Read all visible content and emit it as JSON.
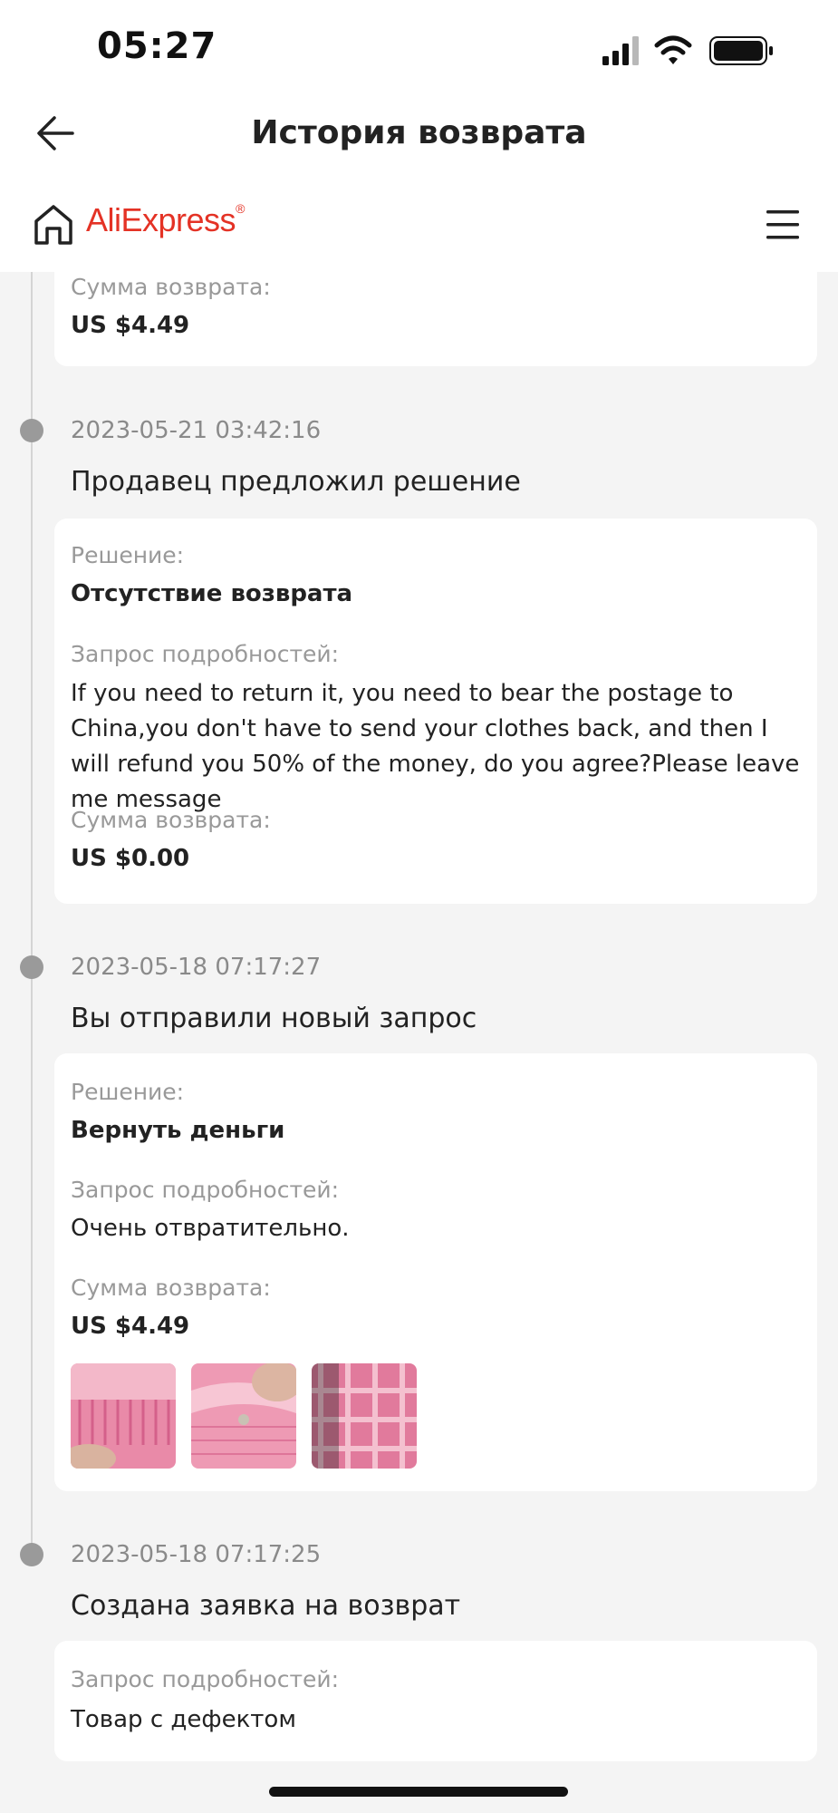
{
  "status_bar": {
    "time": "05:27"
  },
  "header": {
    "title": "История возврата"
  },
  "brand": {
    "part1": "Ali",
    "part2": "Express",
    "tm": "®"
  },
  "icons": {
    "back": "arrow-left-icon",
    "home": "home-icon",
    "menu": "hamburger-menu-icon",
    "signal": "cellular-signal-icon",
    "wifi": "wifi-icon",
    "battery": "battery-icon"
  },
  "colors": {
    "brand": "#e43225",
    "timeline_dot": "#9a9a9a",
    "background": "#f4f4f4"
  },
  "top_card": {
    "amount_label": "Сумма возврата:",
    "amount_value": "US $4.49"
  },
  "events": [
    {
      "date": "2023-05-21 03:42:16",
      "title": "Продавец предложил решение",
      "solution_label": "Решение:",
      "solution_value": "Отсутствие возврата",
      "details_label": "Запрос подробностей:",
      "details_value": "If you need to return it, you need to bear the postage to China,you don't have to send your clothes back, and then I will refund you 50% of the money, do you agree?Please leave me message",
      "amount_label": "Сумма возврата:",
      "amount_value": "US $0.00"
    },
    {
      "date": "2023-05-18 07:17:27",
      "title": "Вы отправили новый запрос",
      "solution_label": "Решение:",
      "solution_value": "Вернуть деньги",
      "details_label": "Запрос подробностей:",
      "details_value": "Очень отвратительно.",
      "amount_label": "Сумма возврата:",
      "amount_value": "US $4.49",
      "photos": [
        "pink-fabric-photo-1",
        "pink-fabric-photo-2",
        "pink-fabric-photo-3"
      ]
    },
    {
      "date": "2023-05-18 07:17:25",
      "title": "Создана заявка на возврат",
      "details_label": "Запрос подробностей:",
      "details_value": "Товар с дефектом"
    }
  ]
}
